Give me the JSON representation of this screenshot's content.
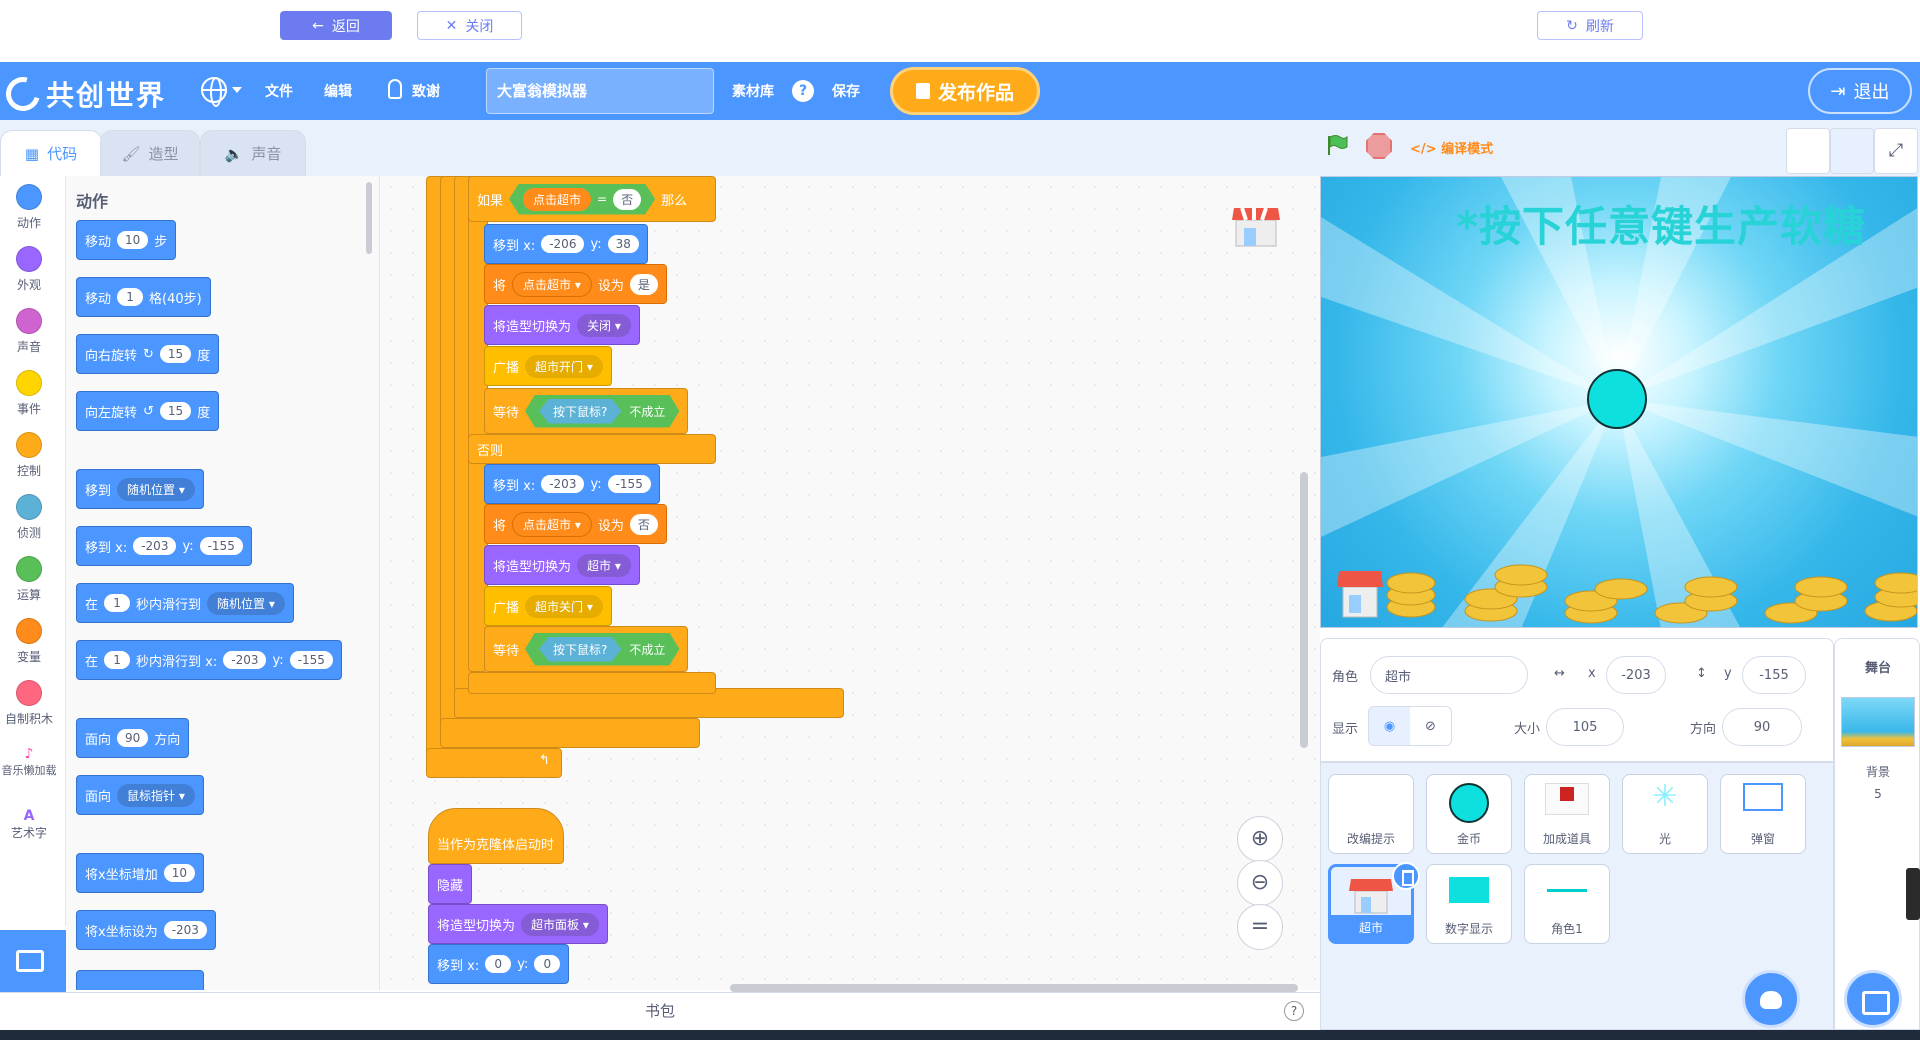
{
  "topbar": {
    "back": "返回",
    "close": "关闭",
    "refresh": "刷新"
  },
  "menu": {
    "logo": "共创世界",
    "file": "文件",
    "edit": "编辑",
    "debug": "致谢",
    "project_title": "大富翁模拟器",
    "assets": "素材库",
    "save": "保存",
    "publish": "发布作品",
    "logout": "退出"
  },
  "tabs": {
    "code": "代码",
    "costumes": "造型",
    "sounds": "声音"
  },
  "categories": [
    {
      "label": "动作",
      "color": "#4c97ff"
    },
    {
      "label": "外观",
      "color": "#9966ff"
    },
    {
      "label": "声音",
      "color": "#cf63cf"
    },
    {
      "label": "事件",
      "color": "#ffd500"
    },
    {
      "label": "控制",
      "color": "#ffab19"
    },
    {
      "label": "侦测",
      "color": "#5cb1d6"
    },
    {
      "label": "运算",
      "color": "#59c059"
    },
    {
      "label": "变量",
      "color": "#ff8c1a"
    },
    {
      "label": "自制积木",
      "color": "#ff6680"
    },
    {
      "label": "音乐懒加载",
      "color": ""
    },
    {
      "label": "艺术字",
      "color": ""
    }
  ],
  "palette": {
    "title": "动作",
    "b1": {
      "a": "移动",
      "v": "10",
      "b": "步"
    },
    "b2": {
      "a": "移动",
      "v": "1",
      "b": "格(40步)"
    },
    "b3": {
      "a": "向右旋转",
      "v": "15",
      "b": "度"
    },
    "b4": {
      "a": "向左旋转",
      "v": "15",
      "b": "度"
    },
    "b5": {
      "a": "移到",
      "d": "随机位置"
    },
    "b6": {
      "a": "移到 x:",
      "x": "-203",
      "yl": "y:",
      "y": "-155"
    },
    "b7": {
      "a": "在",
      "v": "1",
      "b": "秒内滑行到",
      "d": "随机位置"
    },
    "b8": {
      "a": "在",
      "v": "1",
      "b": "秒内滑行到 x:",
      "x": "-203",
      "yl": "y:",
      "y": "-155"
    },
    "b9": {
      "a": "面向",
      "v": "90",
      "b": "方向"
    },
    "b10": {
      "a": "面向",
      "d": "鼠标指针"
    },
    "b11": {
      "a": "将x坐标增加",
      "v": "10"
    },
    "b12": {
      "a": "将x坐标设为",
      "v": "-203"
    }
  },
  "script": {
    "if": "如果",
    "then": "那么",
    "cond_var": "点击超市",
    "eq": "=",
    "cond_val": "否",
    "s1": {
      "a": "移到 x:",
      "x": "-206",
      "yl": "y:",
      "y": "38"
    },
    "s2": {
      "a": "将",
      "d": "点击超市",
      "b": "设为",
      "v": "是"
    },
    "s3": {
      "a": "将造型切换为",
      "d": "关闭"
    },
    "s4": {
      "a": "广播",
      "d": "超市开门"
    },
    "s5": {
      "a": "等待",
      "h": "按下鼠标?",
      "b": "不成立"
    },
    "else": "否则",
    "s6": {
      "a": "移到 x:",
      "x": "-203",
      "yl": "y:",
      "y": "-155"
    },
    "s7": {
      "a": "将",
      "d": "点击超市",
      "b": "设为",
      "v": "否"
    },
    "s8": {
      "a": "将造型切换为",
      "d": "超市"
    },
    "s9": {
      "a": "广播",
      "d": "超市关门"
    },
    "s10": {
      "a": "等待",
      "h": "按下鼠标?",
      "b": "不成立"
    },
    "hat": "当作为克隆体启动时",
    "h1": "隐藏",
    "h2": {
      "a": "将造型切换为",
      "d": "超市面板"
    },
    "h3": {
      "a": "移到 x:",
      "x": "0",
      "yl": "y:",
      "y": "0"
    }
  },
  "backpack": "书包",
  "stage": {
    "compile_mode": "编译模式",
    "title": "*按下任意键生产软糖"
  },
  "sprite_info": {
    "sprite_label": "角色",
    "sprite_name": "超市",
    "x_label": "x",
    "x": "-203",
    "y_label": "y",
    "y": "-155",
    "show_label": "显示",
    "size_label": "大小",
    "size": "105",
    "dir_label": "方向",
    "dir": "90"
  },
  "sprites": [
    {
      "label": "改编提示"
    },
    {
      "label": "金币"
    },
    {
      "label": "加成道具"
    },
    {
      "label": "光"
    },
    {
      "label": "弹窗"
    },
    {
      "label": "超市"
    },
    {
      "label": "数字显示"
    },
    {
      "label": "角色1"
    }
  ],
  "stage_pane": {
    "label": "舞台",
    "backdrop_label": "背景",
    "backdrop_count": "5"
  }
}
